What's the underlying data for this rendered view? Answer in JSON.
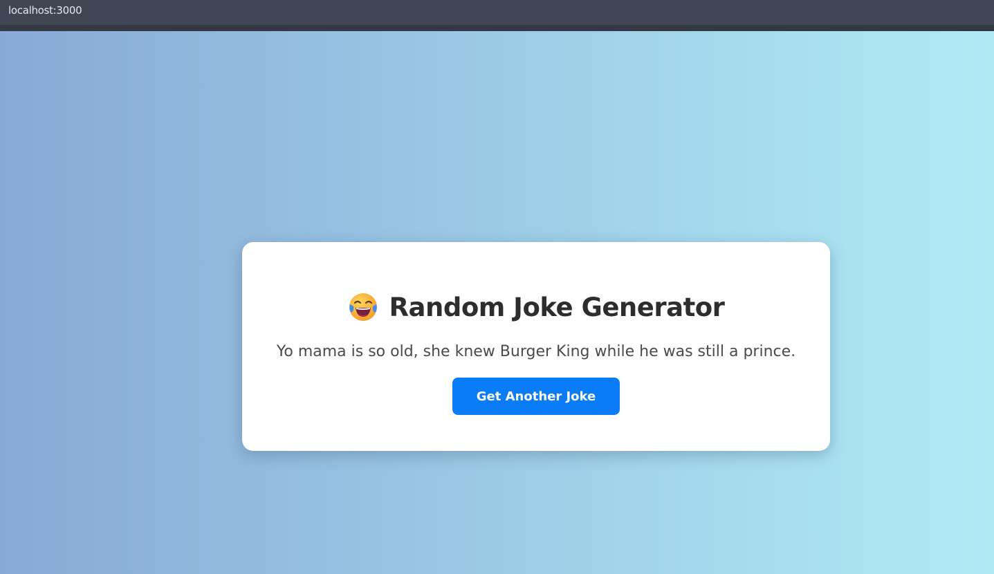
{
  "browser": {
    "url": "localhost:3000"
  },
  "card": {
    "emoji_icon": "face-with-tears-of-joy-icon",
    "title": "Random Joke Generator",
    "joke": "Yo mama is so old, she knew Burger King while he was still a prince.",
    "button_label": "Get Another Joke"
  },
  "colors": {
    "gradient_start": "#88a9d6",
    "gradient_end": "#b0ebf4",
    "button": "#0a7cf8",
    "card": "#ffffff",
    "title_text": "#2d2d2d",
    "browser_bar": "#3f4553"
  }
}
